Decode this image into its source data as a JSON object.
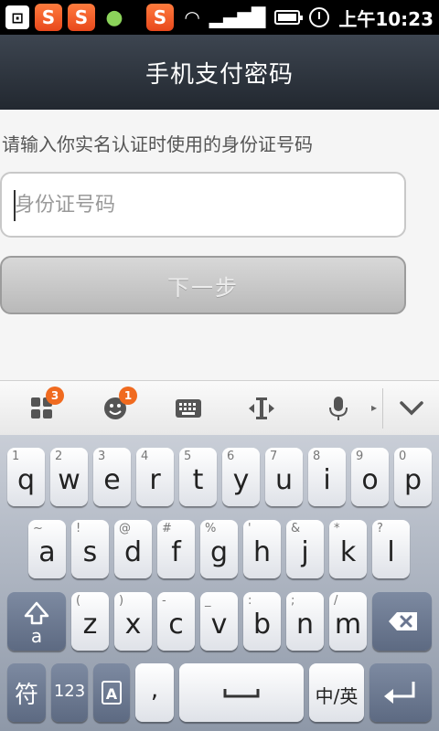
{
  "status_bar": {
    "time": "上午10:23"
  },
  "title": "手机支付密码",
  "prompt": "请输入你实名认证时使用的身份证号码",
  "id_input": {
    "placeholder": "身份证号码",
    "value": ""
  },
  "next_button": "下一步",
  "ime_toolbar": {
    "badge_apps": "3",
    "badge_emoji": "1"
  },
  "keyboard": {
    "row1": [
      {
        "hint": "1",
        "char": "q"
      },
      {
        "hint": "2",
        "char": "w"
      },
      {
        "hint": "3",
        "char": "e"
      },
      {
        "hint": "4",
        "char": "r"
      },
      {
        "hint": "5",
        "char": "t"
      },
      {
        "hint": "6",
        "char": "y"
      },
      {
        "hint": "7",
        "char": "u"
      },
      {
        "hint": "8",
        "char": "i"
      },
      {
        "hint": "9",
        "char": "o"
      },
      {
        "hint": "0",
        "char": "p"
      }
    ],
    "row2": [
      {
        "hint": "~",
        "char": "a"
      },
      {
        "hint": "!",
        "char": "s"
      },
      {
        "hint": "@",
        "char": "d"
      },
      {
        "hint": "#",
        "char": "f"
      },
      {
        "hint": "%",
        "char": "g"
      },
      {
        "hint": "'",
        "char": "h"
      },
      {
        "hint": "&",
        "char": "j"
      },
      {
        "hint": "*",
        "char": "k"
      },
      {
        "hint": "?",
        "char": "l"
      }
    ],
    "row3": [
      {
        "hint": "(",
        "char": "z"
      },
      {
        "hint": ")",
        "char": "x"
      },
      {
        "hint": "-",
        "char": "c"
      },
      {
        "hint": "_",
        "char": "v"
      },
      {
        "hint": ":",
        "char": "b"
      },
      {
        "hint": ";",
        "char": "n"
      },
      {
        "hint": "/",
        "char": "m"
      }
    ],
    "shift_label": "a",
    "symbol_key": "符",
    "number_key": "123",
    "comma_key": ",",
    "lang_key": "中/英"
  }
}
